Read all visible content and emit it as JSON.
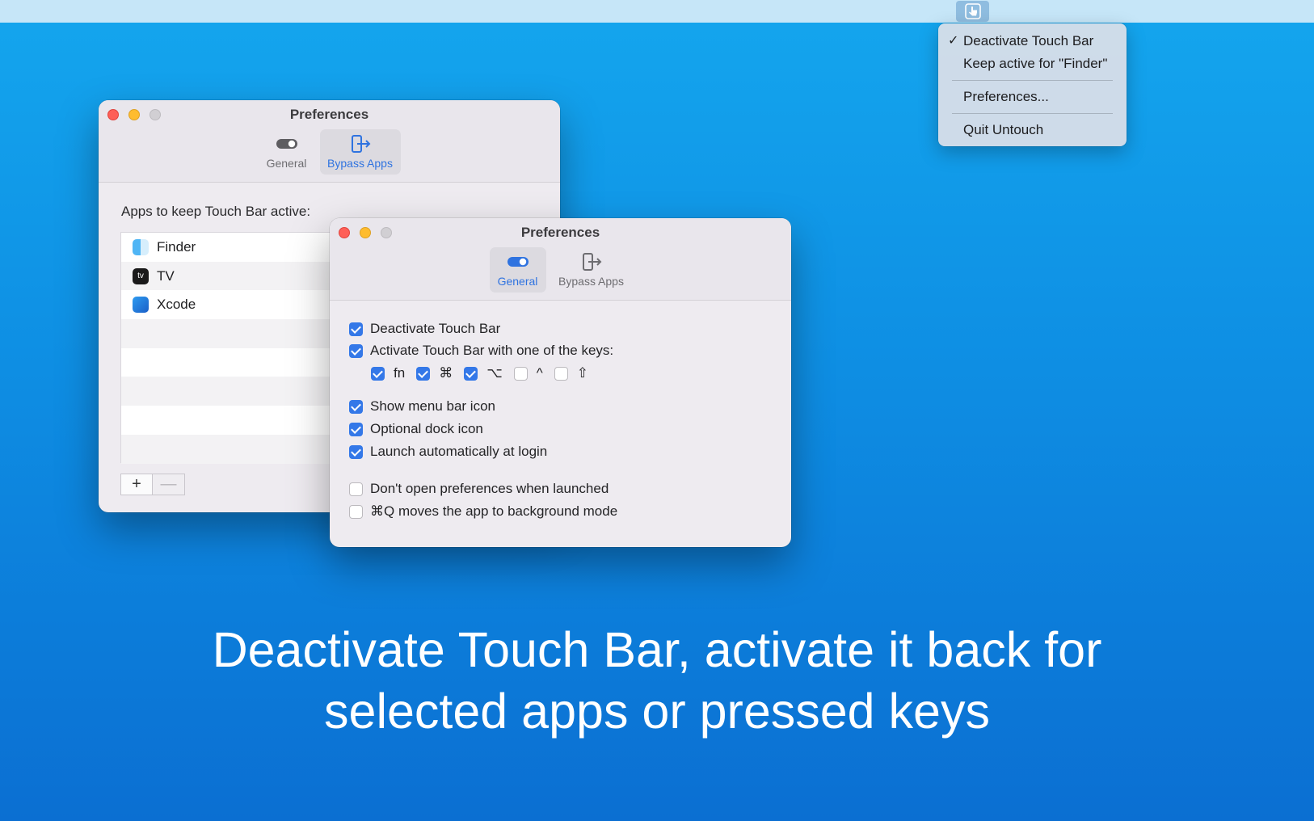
{
  "menubar": {
    "icon": "touch-hand-icon"
  },
  "menu": {
    "check_mark": "✓",
    "items": [
      {
        "label": "Deactivate Touch Bar"
      },
      {
        "label": "Keep active for \"Finder\""
      },
      {
        "label": "Preferences..."
      },
      {
        "label": "Quit Untouch"
      }
    ]
  },
  "back_window": {
    "title": "Preferences",
    "tabs": [
      {
        "label": "General"
      },
      {
        "label": "Bypass Apps"
      }
    ],
    "apps_label": "Apps to keep Touch Bar active:",
    "apps": [
      {
        "name": "Finder",
        "icon": "finder-icon"
      },
      {
        "name": "TV",
        "icon": "tv-icon",
        "icon_text": "tv"
      },
      {
        "name": "Xcode",
        "icon": "xcode-icon"
      }
    ],
    "add_label": "+",
    "remove_label": "—"
  },
  "front_window": {
    "title": "Preferences",
    "tabs": [
      {
        "label": "General"
      },
      {
        "label": "Bypass Apps"
      }
    ],
    "options": [
      {
        "label": "Deactivate Touch Bar",
        "checked": true
      },
      {
        "label": "Activate Touch Bar with one of the keys:",
        "checked": true
      },
      {
        "label": "Show menu bar icon",
        "checked": true
      },
      {
        "label": "Optional dock icon",
        "checked": true
      },
      {
        "label": "Launch automatically at login",
        "checked": true
      },
      {
        "label": "Don't open preferences when launched",
        "checked": false
      },
      {
        "label": "⌘Q moves the app to background mode",
        "checked": false
      }
    ],
    "keys": [
      {
        "label": "fn",
        "checked": true
      },
      {
        "label": "⌘",
        "checked": true
      },
      {
        "label": "⌥",
        "checked": true
      },
      {
        "label": "^",
        "checked": false
      },
      {
        "label": "⇧",
        "checked": false
      }
    ]
  },
  "caption": {
    "line1": "Deactivate Touch Bar, activate it back for",
    "line2": "selected apps or pressed keys"
  },
  "colors": {
    "accent": "#3478e8",
    "background_top": "#14a6ee",
    "background_bottom": "#0b6fd2"
  }
}
